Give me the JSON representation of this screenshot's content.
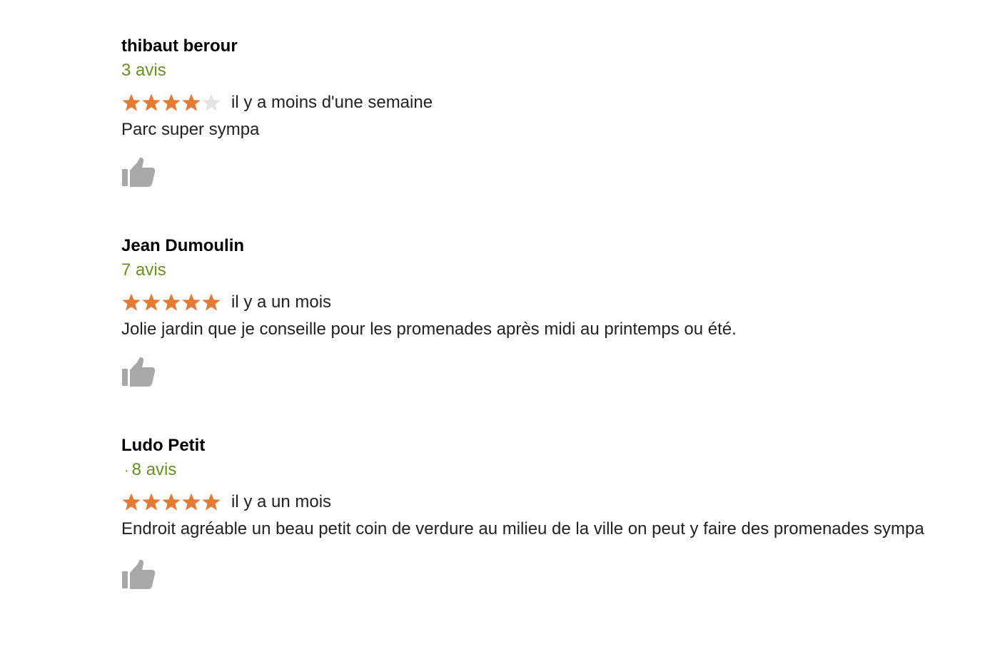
{
  "colors": {
    "star_filled": "#e37b35",
    "star_empty": "#e3e3e3",
    "count_text": "#6b8e23",
    "like_icon": "#a8a8a8"
  },
  "reviews": [
    {
      "author": "thibaut berour",
      "count_prefix": "",
      "count": "3 avis",
      "rating": 4,
      "max_rating": 5,
      "when": "il y a moins d'une semaine",
      "text": "Parc super sympa",
      "like_icon": "thumbs-up-icon"
    },
    {
      "author": "Jean Dumoulin",
      "count_prefix": "",
      "count": "7 avis",
      "rating": 5,
      "max_rating": 5,
      "when": "il y a un mois",
      "text": "Jolie jardin que je conseille pour les promenades après midi au printemps ou été.",
      "like_icon": "thumbs-up-icon"
    },
    {
      "author": "Ludo Petit",
      "count_prefix": "·",
      "count": "8 avis",
      "rating": 5,
      "max_rating": 5,
      "when": "il y a un mois",
      "text": "Endroit agréable un beau petit coin de verdure au milieu de la ville on peut y faire des promenades sympa",
      "like_icon": "thumbs-up-icon"
    }
  ]
}
